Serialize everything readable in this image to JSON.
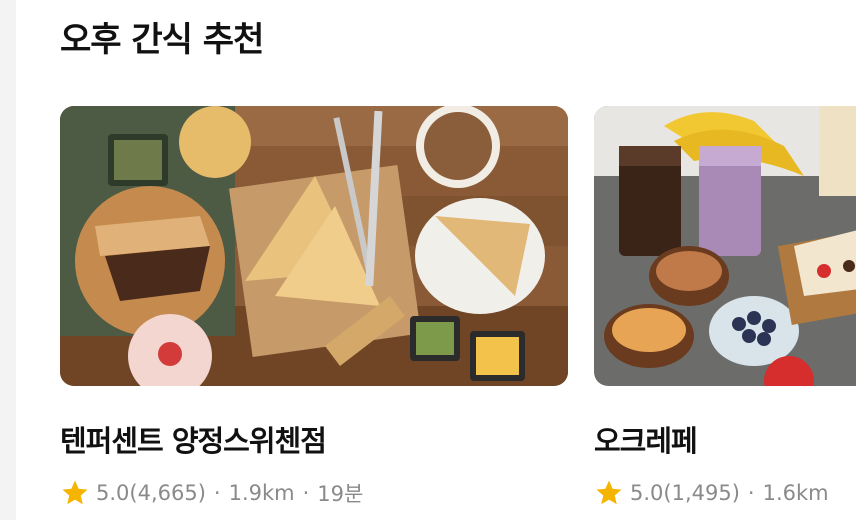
{
  "section": {
    "title": "오후 간식 추천"
  },
  "cards": [
    {
      "name": "텐퍼센트 양정스위첸점",
      "rating": "5.0(4,665)",
      "distance": "1.9km",
      "time": "19분"
    },
    {
      "name": "오크레페",
      "rating": "5.0(1,495)",
      "distance": "1.6km"
    }
  ],
  "colors": {
    "star": "#f5b400",
    "meta_text": "#8a8a8a",
    "title_text": "#111111"
  }
}
